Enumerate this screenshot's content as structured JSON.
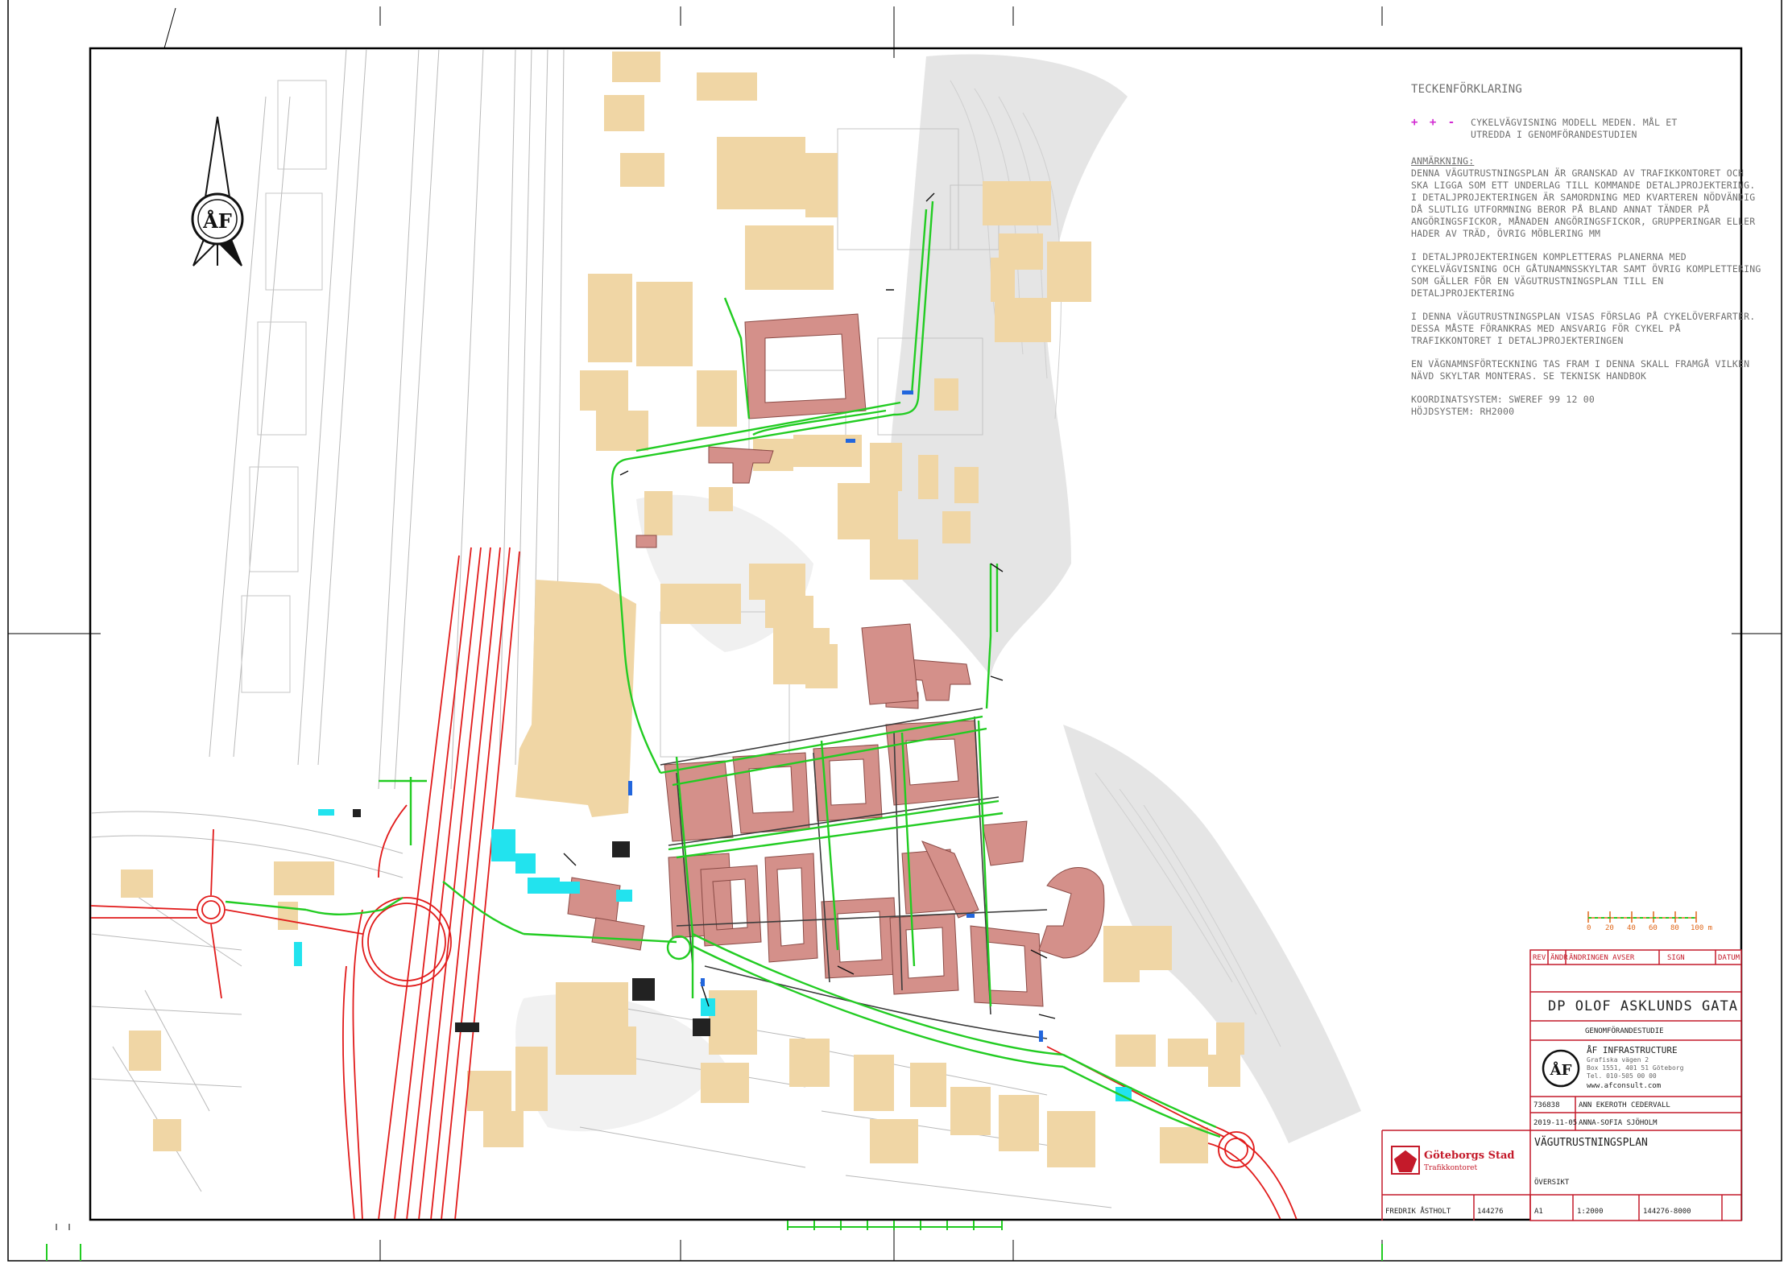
{
  "legend": {
    "heading": "TECKENFÖRKLARING",
    "symbol_text": "CYKELVÄGVISNING MODELL MEDEN. MÅL ET UTREDDA I GENOMFÖRANDESTUDIEN",
    "notes_heading": "ANMÄRKNING:",
    "notes": [
      "DENNA VÄGUTRUSTNINGSPLAN ÄR GRANSKAD AV TRAFIKKONTORET OCH SKA LIGGA SOM ETT UNDERLAG TILL KOMMANDE DETALJPROJEKTERING. I DETALJPROJEKTERINGEN ÄR SAMORDNING MED KVARTEREN NÖDVÄNDIG DÅ SLUTLIG UTFORMNING BEROR PÅ BLAND ANNAT TÄNDER PÅ ANGÖRINGSFICKOR, MÅNADEN ANGÖRINGSFICKOR, GRUPPERINGAR ELLER HADER AV TRÄD, ÖVRIG MÖBLERING MM",
      "I DETALJPROJEKTERINGEN KOMPLETTERAS PLANERNA MED CYKELVÄGVISNING OCH GÅTUNAMNSSKYLTAR SAMT ÖVRIG KOMPLETTERING SOM GÄLLER FÖR EN VÄGUTRUSTNINGSPLAN TILL EN DETALJPROJEKTERING",
      "I DENNA VÄGUTRUSTNINGSPLAN VISAS FÖRSLAG PÅ CYKELÖVERFARTER. DESSA MÅSTE FÖRANKRAS MED ANSVARIG FÖR CYKEL PÅ TRAFIKKONTORET I DETALJPROJEKTERINGEN",
      "EN VÄGNAMNSFÖRTECKNING TAS FRAM I DENNA SKALL FRAMGÅ VILKEN NÄVD SKYLTAR MONTERAS. SE TEKNISK HANDBOK",
      "KOORDINATSYSTEM: SWEREF 99 12 00\nHÖJDSYSTEM: RH2000"
    ]
  },
  "scale_bar": {
    "labels": [
      "0",
      "20",
      "40",
      "60",
      "80",
      "100 m"
    ]
  },
  "title_block": {
    "header_cells": [
      "REV",
      "ÄNDR",
      "ÄNDRINGEN AVSER",
      "SIGN",
      "DATUM"
    ],
    "project_title": "DP OLOF ASKLUNDS GATA",
    "project_subtitle": "GENOMFÖRANDESTUDIE",
    "consultant_name": "ÅF INFRASTRUCTURE",
    "consultant_address": [
      "Grafiska vägen 2",
      "Box 1551, 401 51 Göteborg",
      "Tel. 010-505 00 00",
      "www.afconsult.com"
    ],
    "row1": [
      "736838",
      "ANN EKEROTH CEDERVALL"
    ],
    "row2": [
      "2019-11-05",
      "ANNA-SOFIA SJÖHOLM"
    ],
    "drawing_type": "VÄGUTRUSTNINGSPLAN",
    "drawing_view": "ÖVERSIKT",
    "client_name": "Göteborgs Stad",
    "client_dept": "Trafikkontoret",
    "bottom_row": [
      "FREDRIK ÅSTHOLT",
      "144276",
      "A1",
      "1:2000",
      "144276-8000"
    ]
  },
  "colors": {
    "building": "#f0d6a5",
    "new_building": "#d4908a",
    "cycle_route": "#22cc22",
    "main_road": "#e11b1b",
    "terrain": "#d6d6d6",
    "frame": "#000000",
    "legend_symbol": "#d22bd2",
    "scale_bar": "#e0671a"
  },
  "north_arrow": {
    "icon": "compass-north-arrow",
    "logo_letters": "ÅF"
  }
}
